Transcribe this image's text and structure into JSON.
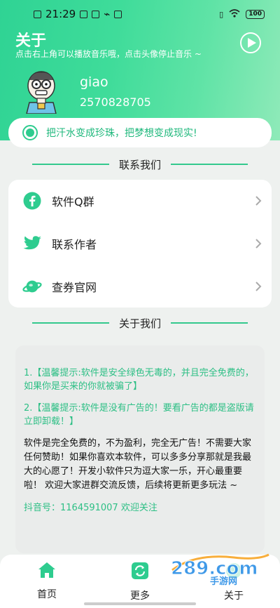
{
  "status_bar": {
    "time": "21:29",
    "battery": "100"
  },
  "header": {
    "title": "关于",
    "hint": "点击右上角可以播放音乐哦，点击头像停止音乐 ~"
  },
  "profile": {
    "name": "giao",
    "id": "2570828705"
  },
  "motto": "把汗水变成珍珠，把梦想变成现实!",
  "contact_section": {
    "title": "联系我们",
    "items": [
      {
        "label": "软件Q群",
        "icon": "facebook-icon"
      },
      {
        "label": "联系作者",
        "icon": "twitter-icon"
      },
      {
        "label": "查券官网",
        "icon": "planet-icon"
      }
    ]
  },
  "about_section": {
    "title": "关于我们",
    "tip1": "1.【温馨提示:软件是安全绿色无毒的，并且完全免费的，如果你是买来的你就被骗了】",
    "tip2": "2.【温馨提示:软件是没有广告的！要看广告的都是盗版请立即卸载！】",
    "description": "软件是完全免费的，不为盈利，完全无广告！不需要大家任何赞助！如果你喜欢本软件，可以多多分享那就是我最大的心愿了！开发小软件只为逗大家一乐，开心最重要啦！ 欢迎大家进群交流反馈，后续将更新更多玩法 ~",
    "douyin": "抖音号：1164591007 欢迎关注"
  },
  "bottom_nav": {
    "items": [
      {
        "label": "首页",
        "icon": "home-icon"
      },
      {
        "label": "更多",
        "icon": "refresh-icon"
      },
      {
        "label": "关于",
        "icon": "about-icon"
      }
    ]
  },
  "watermark": {
    "text": "289.com",
    "sub": "手游网"
  },
  "colors": {
    "accent": "#2ecc8f",
    "header_gradient_start": "#2fd394",
    "header_gradient_end": "#8feab9"
  }
}
